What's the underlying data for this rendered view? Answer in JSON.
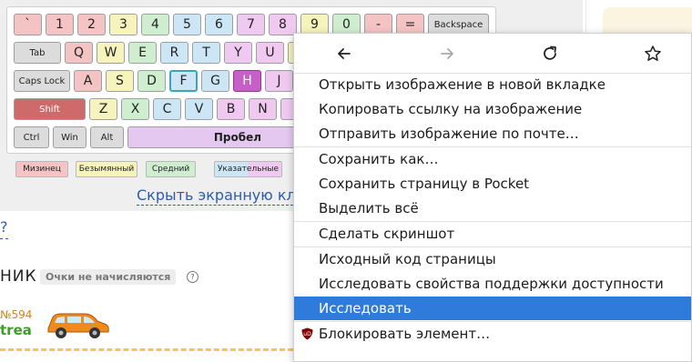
{
  "keyboard": {
    "rows": [
      [
        {
          "label": "`",
          "color": "pink"
        },
        {
          "label": "1",
          "color": "pink"
        },
        {
          "label": "2",
          "color": "pink"
        },
        {
          "label": "3",
          "color": "yellow"
        },
        {
          "label": "4",
          "color": "green"
        },
        {
          "label": "5",
          "color": "blue"
        },
        {
          "label": "6",
          "color": "blue"
        },
        {
          "label": "7",
          "color": "violet"
        },
        {
          "label": "8",
          "color": "violet"
        },
        {
          "label": "9",
          "color": "yellow"
        },
        {
          "label": "0",
          "color": "green"
        },
        {
          "label": "-",
          "color": "pink"
        },
        {
          "label": "=",
          "color": "pink"
        },
        {
          "label": "Backspace",
          "color": "gray"
        }
      ],
      [
        {
          "label": "Tab",
          "color": "gray"
        },
        {
          "label": "Q",
          "color": "pink"
        },
        {
          "label": "W",
          "color": "yellow"
        },
        {
          "label": "E",
          "color": "green"
        },
        {
          "label": "R",
          "color": "blue"
        },
        {
          "label": "T",
          "color": "blue"
        },
        {
          "label": "Y",
          "color": "violet"
        },
        {
          "label": "U",
          "color": "violet"
        }
      ],
      [
        {
          "label": "Caps Lock",
          "color": "gray"
        },
        {
          "label": "A",
          "color": "pink"
        },
        {
          "label": "S",
          "color": "yellow"
        },
        {
          "label": "D",
          "color": "green"
        },
        {
          "label": "F",
          "color": "blue"
        },
        {
          "label": "G",
          "color": "blue"
        },
        {
          "label": "H",
          "color": "violet"
        },
        {
          "label": "J",
          "color": "violet"
        }
      ],
      [
        {
          "label": "Shift",
          "color": "red"
        },
        {
          "label": "Z",
          "color": "yellow"
        },
        {
          "label": "X",
          "color": "green"
        },
        {
          "label": "C",
          "color": "blue"
        },
        {
          "label": "V",
          "color": "blue"
        },
        {
          "label": "B",
          "color": "violet"
        },
        {
          "label": "N",
          "color": "violet"
        }
      ],
      [
        {
          "label": "Ctrl",
          "color": "gray"
        },
        {
          "label": "Win",
          "color": "gray"
        },
        {
          "label": "Alt",
          "color": "gray"
        },
        {
          "label": "Пробел",
          "color": "space"
        }
      ]
    ],
    "legend": [
      {
        "label": "Мизинец",
        "color": "pink"
      },
      {
        "label": "Безымянный",
        "color": "yellow"
      },
      {
        "label": "Средний",
        "color": "green"
      },
      {
        "label": "Указательные",
        "color": "blue"
      }
    ],
    "hide_link": "Скрыть экранную кл"
  },
  "page": {
    "question_link": "?",
    "nik_text": "НИК",
    "no_score_badge": "Очки не начисляются",
    "number_text": "№594",
    "trea_text": "trea"
  },
  "menu": {
    "nav": [
      {
        "name": "back-icon",
        "enabled": true
      },
      {
        "name": "forward-icon",
        "enabled": false
      },
      {
        "name": "reload-icon",
        "enabled": true
      },
      {
        "name": "bookmark-star-icon",
        "enabled": true
      }
    ],
    "items": [
      {
        "label": "Открыть изображение в новой вкладке"
      },
      {
        "label": "Копировать ссылку на изображение"
      },
      {
        "label": "Отправить изображение по почте…"
      },
      {
        "label": "Сохранить как…"
      },
      {
        "label": "Сохранить страницу в Pocket"
      },
      {
        "label": "Выделить всё"
      },
      {
        "label": "Сделать скриншот"
      },
      {
        "label": "Исходный код страницы"
      },
      {
        "label": "Исследовать свойства поддержки доступности"
      },
      {
        "label": "Исследовать",
        "highlighted": true
      },
      {
        "label": "Блокировать элемент…",
        "icon": "ublock-shield-icon"
      }
    ]
  },
  "colors": {
    "menu_highlight": "#2f7bdc",
    "link": "#2a5db0",
    "pressed_key": "#c65fc8",
    "shift_key": "#cf6a6a"
  }
}
